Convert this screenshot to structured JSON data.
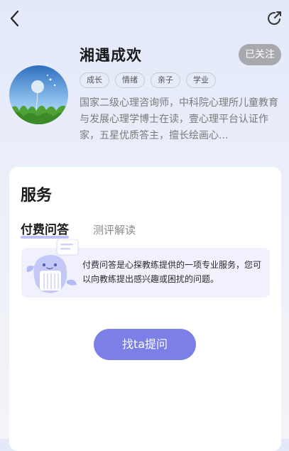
{
  "profile": {
    "name": "湘遇成欢",
    "follow_label": "已关注",
    "tags": [
      "成长",
      "情绪",
      "亲子",
      "学业"
    ],
    "bio": "国家二级心理咨询师，中科院心理所儿童教育与发展心理学博士在读，壹心理平台认证作家，五星优质答主，擅长绘画心..."
  },
  "services": {
    "title": "服务",
    "tabs": [
      {
        "label": "付费问答",
        "active": true
      },
      {
        "label": "测评解读",
        "active": false
      }
    ],
    "description": "付费问答是心探教练提供的一项专业服务，您可以向教练提出感兴趣或困扰的问题。",
    "ask_button_label": "找ta提问"
  },
  "icons": {
    "back": "chevron-left-icon",
    "share": "share-icon",
    "mascot": "whale-mascot-icon"
  },
  "colors": {
    "accent": "#7b7fe6",
    "follow_bg": "#a8a9ae",
    "info_bg": "#f0f1fd"
  }
}
